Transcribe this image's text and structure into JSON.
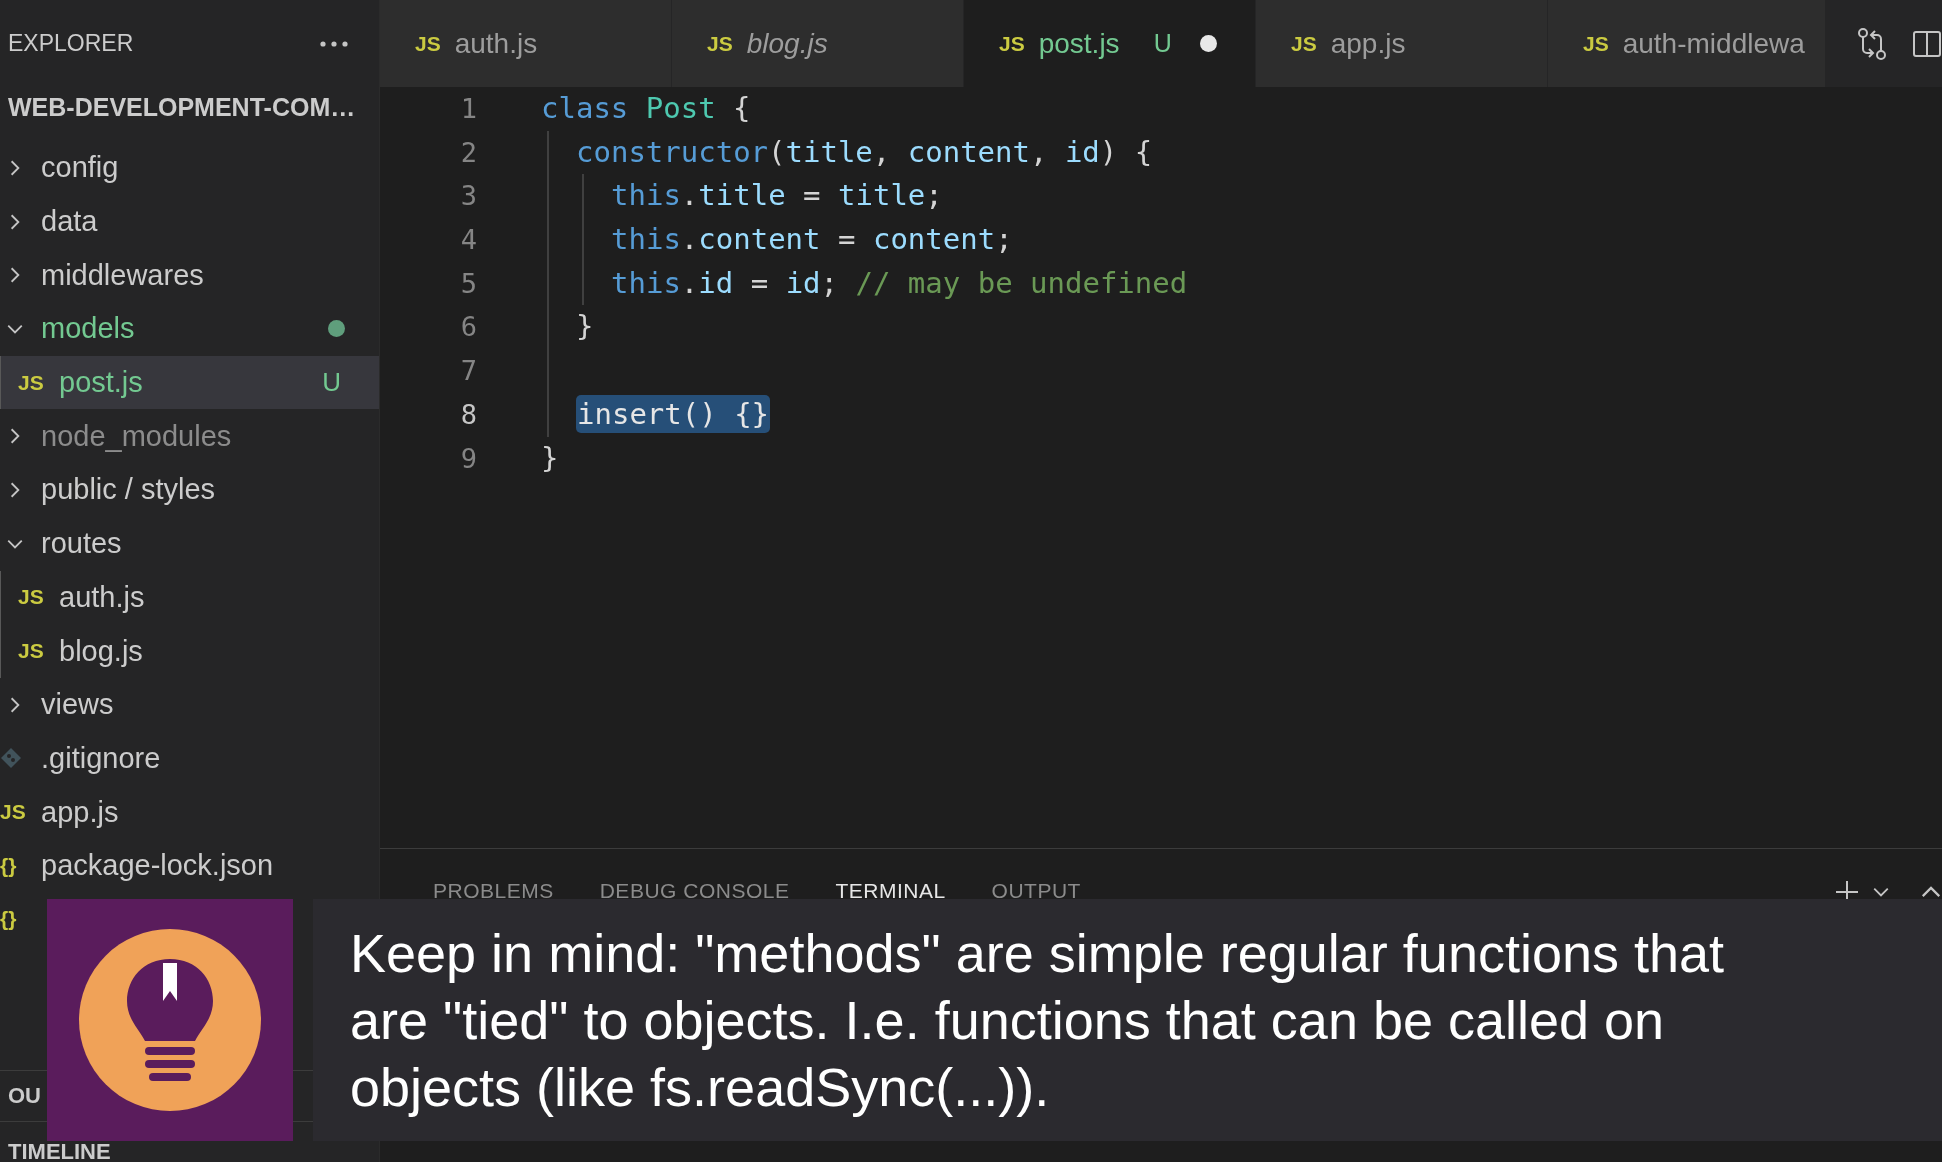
{
  "sidebar": {
    "title": "EXPLORER",
    "project": "WEB-DEVELOPMENT-COM…",
    "tree": [
      {
        "kind": "folder",
        "name": "config",
        "expanded": false,
        "contains_changes": false,
        "untracked": false,
        "ignored": false,
        "selected": false
      },
      {
        "kind": "folder",
        "name": "data",
        "expanded": false,
        "contains_changes": false,
        "untracked": false,
        "ignored": false,
        "selected": false
      },
      {
        "kind": "folder",
        "name": "middlewares",
        "expanded": false,
        "contains_changes": false,
        "untracked": false,
        "ignored": false,
        "selected": false
      },
      {
        "kind": "folder",
        "name": "models",
        "expanded": true,
        "contains_changes": true,
        "untracked": true,
        "ignored": false,
        "selected": false,
        "children": [
          {
            "kind": "js_file",
            "icon": "JS",
            "name": "post.js",
            "badge": "U",
            "untracked": true,
            "ignored": false,
            "selected": true
          }
        ]
      },
      {
        "kind": "folder",
        "name": "node_modules",
        "expanded": false,
        "contains_changes": false,
        "untracked": false,
        "ignored": true,
        "selected": false
      },
      {
        "kind": "folder",
        "name": "public / styles",
        "expanded": false,
        "contains_changes": false,
        "untracked": false,
        "ignored": false,
        "selected": false
      },
      {
        "kind": "folder",
        "name": "routes",
        "expanded": true,
        "contains_changes": false,
        "untracked": false,
        "ignored": false,
        "selected": false,
        "children": [
          {
            "kind": "js_file",
            "icon": "JS",
            "name": "auth.js",
            "untracked": false,
            "ignored": false,
            "selected": false
          },
          {
            "kind": "js_file",
            "icon": "JS",
            "name": "blog.js",
            "untracked": false,
            "ignored": false,
            "selected": false
          }
        ]
      },
      {
        "kind": "folder",
        "name": "views",
        "expanded": false,
        "contains_changes": false,
        "untracked": false,
        "ignored": false,
        "selected": false
      },
      {
        "kind": "git_file",
        "name": ".gitignore",
        "untracked": false,
        "ignored": false,
        "selected": false
      },
      {
        "kind": "js_file",
        "icon": "JS",
        "name": "app.js",
        "untracked": false,
        "ignored": false,
        "selected": false
      },
      {
        "kind": "json_file",
        "icon": "{}",
        "name": "package-lock.json",
        "untracked": false,
        "ignored": false,
        "selected": false
      },
      {
        "kind": "json_file",
        "icon": "{}",
        "selected": false
      }
    ],
    "sections": [
      {
        "title": "OU"
      },
      {
        "title": "TIMELINE"
      }
    ]
  },
  "tabs": [
    {
      "icon": "JS",
      "label": "auth.js",
      "selected": false,
      "preview": false,
      "dirty": false
    },
    {
      "icon": "JS",
      "label": "blog.js",
      "selected": false,
      "preview": true,
      "dirty": false
    },
    {
      "icon": "JS",
      "label": "post.js",
      "badge": "U",
      "selected": true,
      "preview": false,
      "dirty": true
    },
    {
      "icon": "JS",
      "label": "app.js",
      "selected": false,
      "preview": false,
      "dirty": false
    },
    {
      "icon": "JS",
      "label": "auth-middlewa",
      "selected": false,
      "preview": false,
      "dirty": false
    }
  ],
  "editor": {
    "lines": [
      {
        "number": "1",
        "current": false,
        "tokens": [
          {
            "kind": "keyword",
            "text": "class "
          },
          {
            "kind": "class",
            "text": "Post"
          },
          {
            "kind": "plain",
            "text": " {"
          }
        ],
        "children": [
          {
            "number": "2",
            "current": false,
            "tokens": [
              {
                "kind": "keyword",
                "text": "constructor"
              },
              {
                "kind": "plain",
                "text": "("
              },
              {
                "kind": "variable",
                "text": "title"
              },
              {
                "kind": "plain",
                "text": ", "
              },
              {
                "kind": "variable",
                "text": "content"
              },
              {
                "kind": "plain",
                "text": ", "
              },
              {
                "kind": "variable",
                "text": "id"
              },
              {
                "kind": "plain",
                "text": ") {"
              }
            ],
            "children": [
              {
                "number": "3",
                "current": false,
                "tokens": [
                  {
                    "kind": "keyword",
                    "text": "this"
                  },
                  {
                    "kind": "plain",
                    "text": "."
                  },
                  {
                    "kind": "variable",
                    "text": "title"
                  },
                  {
                    "kind": "plain",
                    "text": " = "
                  },
                  {
                    "kind": "variable",
                    "text": "title"
                  },
                  {
                    "kind": "plain",
                    "text": ";"
                  }
                ]
              },
              {
                "number": "4",
                "current": false,
                "tokens": [
                  {
                    "kind": "keyword",
                    "text": "this"
                  },
                  {
                    "kind": "plain",
                    "text": "."
                  },
                  {
                    "kind": "variable",
                    "text": "content"
                  },
                  {
                    "kind": "plain",
                    "text": " = "
                  },
                  {
                    "kind": "variable",
                    "text": "content"
                  },
                  {
                    "kind": "plain",
                    "text": ";"
                  }
                ]
              },
              {
                "number": "5",
                "current": false,
                "tokens": [
                  {
                    "kind": "keyword",
                    "text": "this"
                  },
                  {
                    "kind": "plain",
                    "text": "."
                  },
                  {
                    "kind": "variable",
                    "text": "id"
                  },
                  {
                    "kind": "plain",
                    "text": " = "
                  },
                  {
                    "kind": "variable",
                    "text": "id"
                  },
                  {
                    "kind": "plain",
                    "text": "; "
                  },
                  {
                    "kind": "comment",
                    "text": "// may be undefined"
                  }
                ]
              }
            ]
          },
          {
            "number": "6",
            "current": false,
            "tokens": [
              {
                "kind": "plain",
                "text": "}"
              }
            ]
          },
          {
            "number": "7",
            "current": false
          },
          {
            "number": "8",
            "current": true,
            "tokens": [
              {
                "kind": "selection",
                "text": "insert() {}"
              }
            ]
          }
        ]
      },
      {
        "number": "9",
        "current": false,
        "tokens": [
          {
            "kind": "plain",
            "text": "}"
          }
        ]
      }
    ]
  },
  "panel": {
    "tabs": [
      {
        "label": "PROBLEMS",
        "selected": false
      },
      {
        "label": "DEBUG CONSOLE",
        "selected": false
      },
      {
        "label": "TERMINAL",
        "selected": true
      },
      {
        "label": "OUTPUT",
        "selected": false
      }
    ]
  },
  "callout": {
    "text": "Keep in mind: \"methods\" are simple regular functions that are \"tied\" to objects. I.e. functions that can be called on objects (like fs.readSync(...))."
  }
}
